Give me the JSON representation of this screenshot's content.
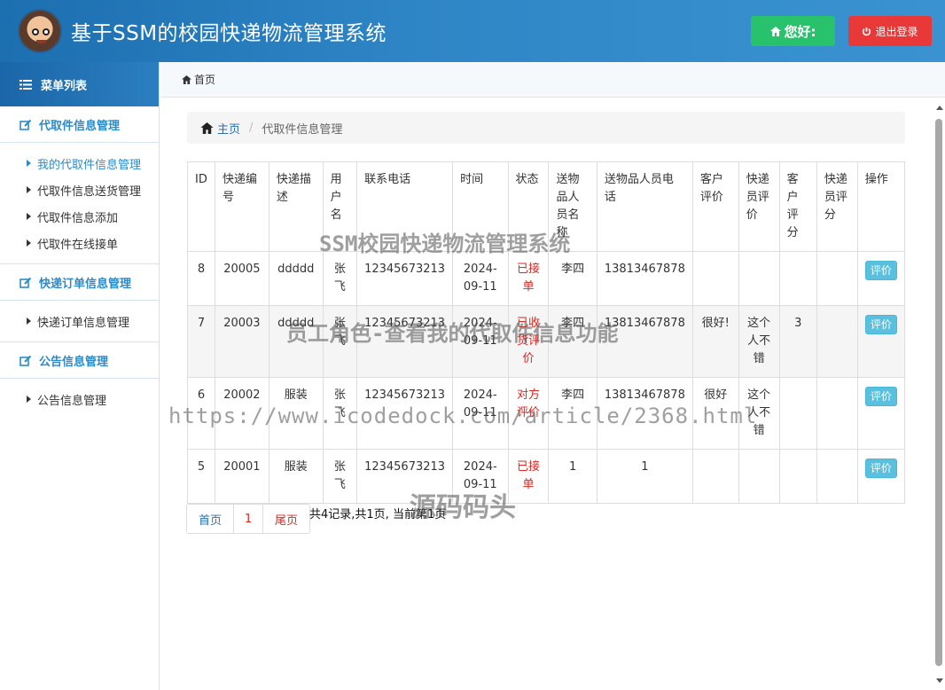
{
  "header": {
    "title": "基于SSM的校园快递物流管理系统",
    "hello_label": "您好:",
    "logout_label": "退出登录"
  },
  "sidebar": {
    "menu_title": "菜单列表",
    "groups": [
      {
        "title": "代取件信息管理",
        "items": [
          "我的代取件信息管理",
          "代取件信息送货管理",
          "代取件信息添加",
          "代取件在线接单"
        ]
      },
      {
        "title": "快递订单信息管理",
        "items": [
          "快递订单信息管理"
        ]
      },
      {
        "title": "公告信息管理",
        "items": [
          "公告信息管理"
        ]
      }
    ]
  },
  "topbar": {
    "home_label": "首页"
  },
  "breadcrumb": {
    "home": "主页",
    "current": "代取件信息管理"
  },
  "table": {
    "headers": [
      "ID",
      "快递编号",
      "快递描述",
      "用户名",
      "联系电话",
      "时间",
      "状态",
      "送物品人员名称",
      "送物品人员电话",
      "客户评价",
      "快递员评价",
      "客户评分",
      "快递员评分",
      "操作"
    ],
    "rows": [
      [
        "8",
        "20005",
        "ddddd",
        "张飞",
        "12345673213",
        "2024-09-11",
        "已接单",
        "李四",
        "13813467878",
        "",
        "",
        "",
        "",
        "评价"
      ],
      [
        "7",
        "20003",
        "ddddd",
        "张飞",
        "12345673213",
        "2024-09-11",
        "已收货评价",
        "李四",
        "13813467878",
        "很好!",
        "这个人不错",
        "3",
        "",
        "评价"
      ],
      [
        "6",
        "20002",
        "服装",
        "张飞",
        "12345673213",
        "2024-09-11",
        "对方评价",
        "李四",
        "13813467878",
        "很好",
        "这个人不错",
        "",
        "",
        "评价"
      ],
      [
        "5",
        "20001",
        "服装",
        "张飞",
        "12345673213",
        "2024-09-11",
        "已接单",
        "1",
        "1",
        "",
        "",
        "",
        "",
        "评价"
      ]
    ]
  },
  "pager": {
    "first": "首页",
    "page": "1",
    "last": "尾页",
    "info": "共4记录,共1页, 当前第1页"
  },
  "watermarks": {
    "line1": "SSM校园快递物流管理系统",
    "line2": "员工角色-查看我的代取件信息功能",
    "line3": "https://www.icodedock.com/article/2368.html",
    "line4": "源码码头"
  },
  "colors": {
    "header": "#2a7dbe",
    "accent": "#2d8ac9",
    "status_red": "#e0261f",
    "hello_green": "#27c26b",
    "logout_red": "#e83838",
    "eval_btn": "#5bc0de"
  },
  "icons": {
    "hello": "home-icon",
    "logout": "power-icon",
    "menu": "list-icon",
    "group": "edit-icon",
    "breadcrumb": "home-icon"
  }
}
